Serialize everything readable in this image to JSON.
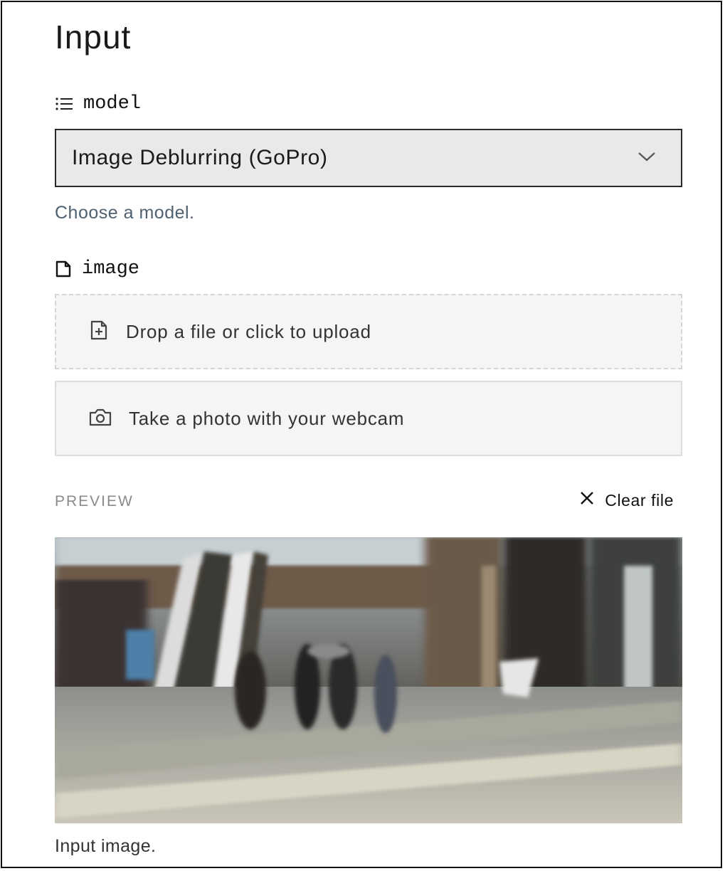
{
  "panel": {
    "heading": "Input"
  },
  "model_field": {
    "label": "model",
    "icon": "list-icon",
    "selected": "Image Deblurring (GoPro)",
    "help": "Choose a model."
  },
  "image_field": {
    "label": "image",
    "icon": "file-icon",
    "upload_text": "Drop a file or click to upload",
    "webcam_text": "Take a photo with your webcam",
    "preview_label": "PREVIEW",
    "clear_label": "Clear file",
    "caption": "Input image."
  },
  "colors": {
    "select_bg": "#e9e9e9",
    "help_text": "#4f6170",
    "box_bg": "#f5f5f5"
  }
}
